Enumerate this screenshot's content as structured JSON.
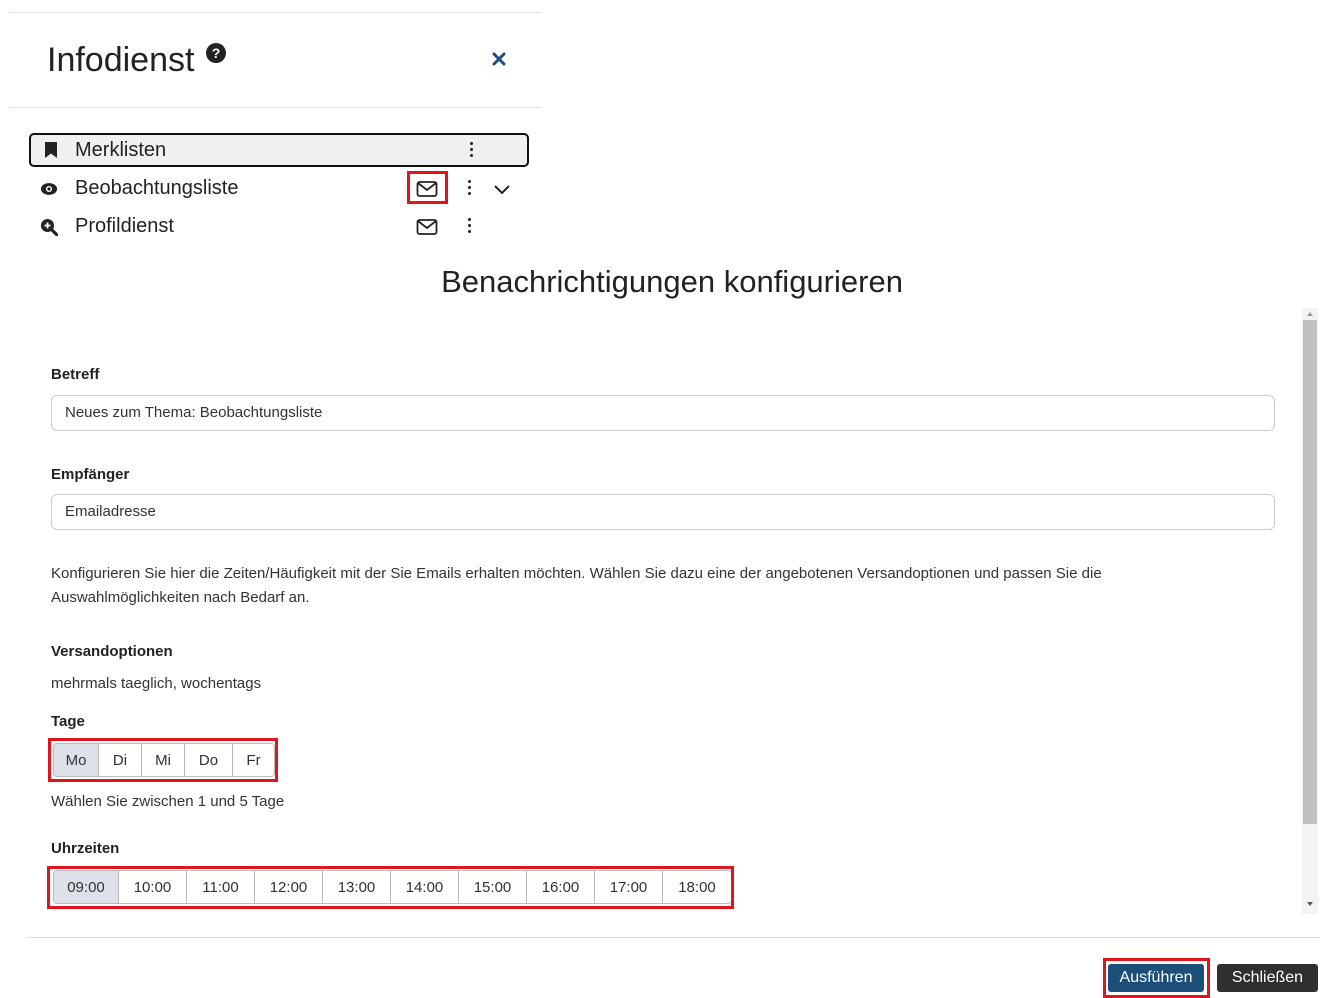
{
  "panel": {
    "title": "Infodienst",
    "items": [
      {
        "label": "Merklisten",
        "icon": "bookmark-icon"
      },
      {
        "label": "Beobachtungsliste",
        "icon": "eye-icon"
      },
      {
        "label": "Profildienst",
        "icon": "search-plus-icon"
      }
    ]
  },
  "dialog": {
    "title": "Benachrichtigungen konfigurieren",
    "subject_label": "Betreff",
    "subject_value": "Neues zum Thema: Beobachtungsliste",
    "recipient_label": "Empfänger",
    "recipient_placeholder": "Emailadresse",
    "info_text_line1": "Konfigurieren Sie hier die Zeiten/Häufigkeit mit der Sie Emails erhalten möchten. Wählen Sie dazu eine der angebotenen Versandoptionen und passen Sie die",
    "info_text_line2": "Auswahlmöglichkeiten nach Bedarf an.",
    "shipping_label": "Versandoptionen",
    "shipping_value": "mehrmals taeglich, wochentags",
    "days_label": "Tage",
    "days": [
      "Mo",
      "Di",
      "Mi",
      "Do",
      "Fr"
    ],
    "days_selected": [
      "Mo"
    ],
    "days_hint": "Wählen Sie zwischen 1 und 5 Tage",
    "times_label": "Uhrzeiten",
    "times": [
      "09:00",
      "10:00",
      "11:00",
      "12:00",
      "13:00",
      "14:00",
      "15:00",
      "16:00",
      "17:00",
      "18:00"
    ],
    "times_selected": [
      "09:00"
    ],
    "execute_label": "Ausführen",
    "close_label": "Schließen"
  },
  "colors": {
    "highlight": "#e1141e",
    "primary_button": "#1b4f7a",
    "secondary_button": "#2f2f2f",
    "selected_segment": "#dde1ea"
  }
}
